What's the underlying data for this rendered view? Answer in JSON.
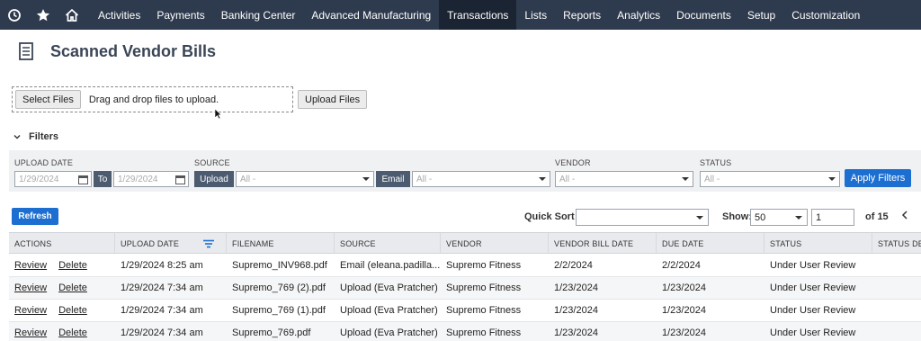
{
  "nav": {
    "icons": [
      "recent-icon",
      "star-icon",
      "home-icon"
    ],
    "items": [
      {
        "label": "Activities"
      },
      {
        "label": "Payments"
      },
      {
        "label": "Banking Center"
      },
      {
        "label": "Advanced Manufacturing"
      },
      {
        "label": "Transactions",
        "active": true
      },
      {
        "label": "Lists"
      },
      {
        "label": "Reports"
      },
      {
        "label": "Analytics"
      },
      {
        "label": "Documents"
      },
      {
        "label": "Setup"
      },
      {
        "label": "Customization"
      }
    ],
    "bg_color": "#2e3a4d"
  },
  "page": {
    "title": "Scanned Vendor Bills",
    "icon": "document-icon"
  },
  "upload": {
    "select_label": "Select Files",
    "drop_text": "Drag and drop files to upload.",
    "upload_label": "Upload Files"
  },
  "filters": {
    "heading": "Filters",
    "upload_date_label": "UPLOAD DATE",
    "date_from": "1/29/2024",
    "to_label": "To",
    "date_to": "1/29/2024",
    "source_label": "SOURCE",
    "upload_tag": "Upload",
    "upload_value": "All -",
    "email_tag": "Email",
    "email_value": "All -",
    "vendor_label": "VENDOR",
    "vendor_value": "All -",
    "status_label": "STATUS",
    "status_value": "All -",
    "apply_label": "Apply Filters"
  },
  "list": {
    "refresh_label": "Refresh",
    "quick_sort_label": "Quick Sort",
    "quick_sort_value": "",
    "show_label": "Show:",
    "show_value": "50",
    "page_value": "1",
    "of_label": "of 15",
    "accent_color": "#1c6fd1"
  },
  "table": {
    "headers": [
      "ACTIONS",
      "UPLOAD DATE",
      "FILENAME",
      "SOURCE",
      "VENDOR",
      "VENDOR BILL DATE",
      "DUE DATE",
      "STATUS",
      "STATUS DES"
    ],
    "review_label": "Review",
    "delete_label": "Delete",
    "rows": [
      {
        "upload_date": "1/29/2024 8:25 am",
        "filename": "Supremo_INV968.pdf",
        "source": "Email (eleana.padilla...",
        "vendor": "Supremo Fitness",
        "bill_date": "2/2/2024",
        "due_date": "2/2/2024",
        "status": "Under User Review"
      },
      {
        "upload_date": "1/29/2024 7:34 am",
        "filename": "Supremo_769 (2).pdf",
        "source": "Upload (Eva Pratcher)",
        "vendor": "Supremo Fitness",
        "bill_date": "1/23/2024",
        "due_date": "1/23/2024",
        "status": "Under User Review"
      },
      {
        "upload_date": "1/29/2024 7:34 am",
        "filename": "Supremo_769 (1).pdf",
        "source": "Upload (Eva Pratcher)",
        "vendor": "Supremo Fitness",
        "bill_date": "1/23/2024",
        "due_date": "1/23/2024",
        "status": "Under User Review"
      },
      {
        "upload_date": "1/29/2024 7:34 am",
        "filename": "Supremo_769.pdf",
        "source": "Upload (Eva Pratcher)",
        "vendor": "Supremo Fitness",
        "bill_date": "1/23/2024",
        "due_date": "1/23/2024",
        "status": "Under User Review"
      }
    ]
  }
}
